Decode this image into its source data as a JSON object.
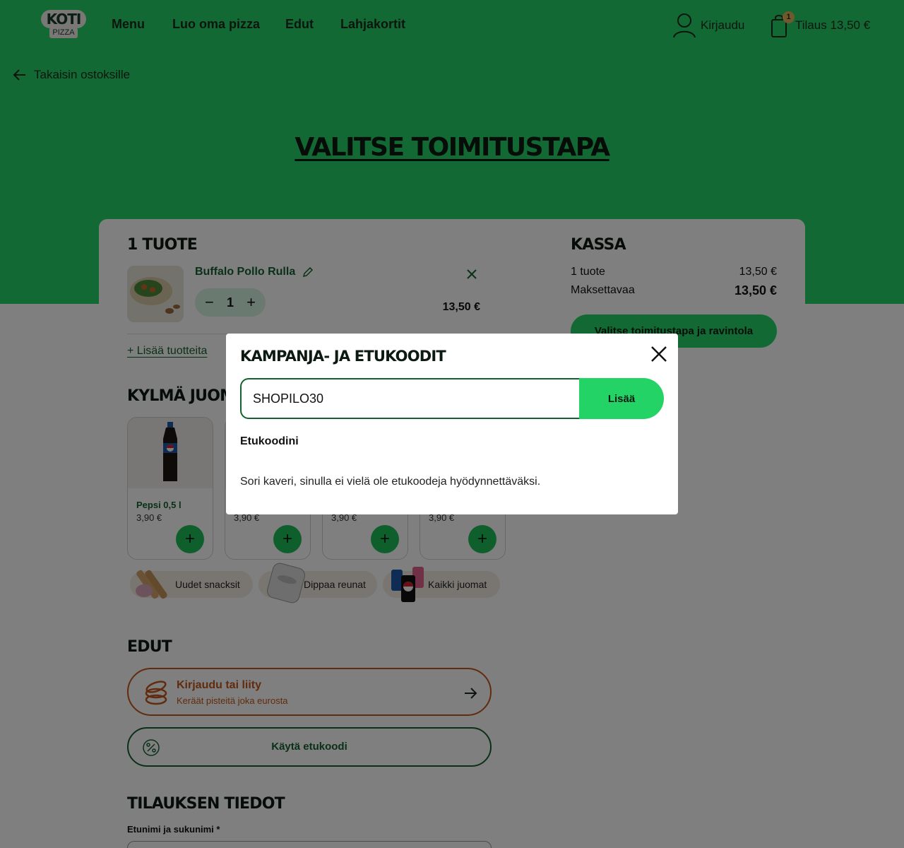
{
  "header": {
    "logo_top": "KOTI",
    "logo_bottom": "PIZZA",
    "nav": [
      "Menu",
      "Luo oma pizza",
      "Edut",
      "Lahjakortit"
    ],
    "login_label": "Kirjaudu",
    "cart_count": "1",
    "cart_label": "Tilaus 13,50 €"
  },
  "back_label": "Takaisin ostoksille",
  "page_title": "VALITSE TOIMITUSTAPA",
  "cart": {
    "heading": "1 TUOTE",
    "item": {
      "name": "Buffalo Pollo Rulla",
      "quantity": "1",
      "price": "13,50 €"
    },
    "add_more": "+ Lisää tuotteita"
  },
  "checkout": {
    "heading": "KASSA",
    "items_label": "1 tuote",
    "items_value": "13,50 €",
    "total_label": "Maksettavaa",
    "total_value": "13,50 €",
    "cta": "Valitse toimitustapa ja ravintola"
  },
  "drinks": {
    "heading": "KYLMÄ JUOM",
    "items": [
      {
        "name": "Pepsi 0,5 l",
        "price": "3,90 €"
      },
      {
        "name": "",
        "price": "3,90 €"
      },
      {
        "name": "",
        "price": "3,90 €"
      },
      {
        "name": "",
        "price": "3,90 €"
      }
    ]
  },
  "chips": [
    "Uudet snacksit",
    "Dippaa reunat",
    "Kaikki juomat"
  ],
  "edut": {
    "heading": "EDUT",
    "login_title": "Kirjaudu tai liity",
    "login_sub": "Keräät pisteitä joka eurosta",
    "code_label": "Käytä etukoodi"
  },
  "order_info": {
    "heading": "TILAUKSEN TIEDOT",
    "name_label": "Etunimi ja sukunimi *"
  },
  "modal": {
    "title": "KAMPANJA- JA ETUKOODIT",
    "input_value": "SHOPILO30",
    "submit": "Lisää",
    "subheading": "Etukoodini",
    "empty_text": "Sori kaveri, sinulla ei vielä ole etukoodeja hyödynnettäväksi."
  },
  "colors": {
    "brand_green": "#24d366",
    "dark_green": "#14622f",
    "accent_orange": "#c2571a"
  }
}
